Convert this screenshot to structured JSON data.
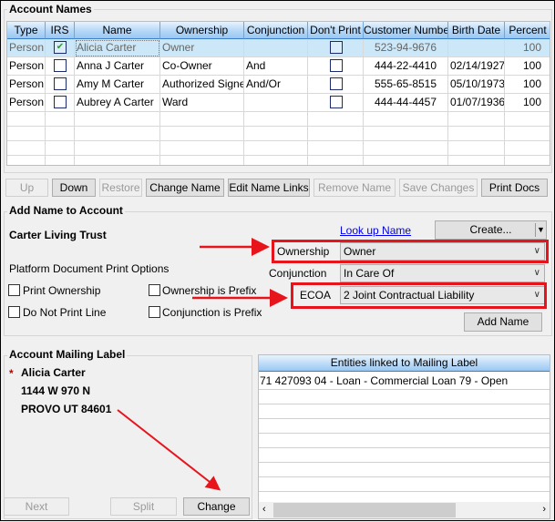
{
  "account_names": {
    "title": "Account Names",
    "columns": [
      "Type",
      "IRS",
      "Name",
      "Ownership",
      "Conjunction",
      "Don't Print",
      "Customer Number",
      "Birth Date",
      "Percent"
    ],
    "rows": [
      {
        "type": "Person",
        "irs": true,
        "name": "Alicia Carter",
        "ownership": "Owner",
        "conjunction": "",
        "dont_print": false,
        "customer_number": "523-94-9676",
        "birth_date": "",
        "percent": "100",
        "selected": true
      },
      {
        "type": "Person",
        "irs": false,
        "name": "Anna J Carter",
        "ownership": "Co-Owner",
        "conjunction": "And",
        "dont_print": false,
        "customer_number": "444-22-4410",
        "birth_date": "02/14/1927",
        "percent": "100"
      },
      {
        "type": "Person",
        "irs": false,
        "name": "Amy M Carter",
        "ownership": "Authorized Signer",
        "conjunction": "And/Or",
        "dont_print": false,
        "customer_number": "555-65-8515",
        "birth_date": "05/10/1973",
        "percent": "100"
      },
      {
        "type": "Person",
        "irs": false,
        "name": "Aubrey A Carter",
        "ownership": "Ward",
        "conjunction": "",
        "dont_print": false,
        "customer_number": "444-44-4457",
        "birth_date": "01/07/1936",
        "percent": "100"
      }
    ]
  },
  "toolbar": {
    "up": "Up",
    "down": "Down",
    "restore": "Restore",
    "change_name": "Change Name",
    "edit_name_links": "Edit Name Links",
    "remove_name": "Remove Name",
    "save_changes": "Save Changes",
    "print_docs": "Print Docs"
  },
  "add_name": {
    "title": "Add Name to Account",
    "account_title": "Carter  Living Trust",
    "lookup_link": "Look up Name",
    "create_button": "Create...",
    "ownership_label": "Ownership",
    "ownership_value": "Owner",
    "conjunction_label": "Conjunction",
    "conjunction_value": "In Care Of",
    "ecoa_label": "ECOA",
    "ecoa_value": "2 Joint Contractual Liability",
    "print_options_label": "Platform Document Print Options",
    "print_ownership": "Print Ownership",
    "ownership_is_prefix": "Ownership is Prefix",
    "do_not_print_line": "Do Not Print Line",
    "conjunction_is_prefix": "Conjunction is Prefix",
    "add_name_button": "Add Name"
  },
  "mailing_label": {
    "title": "Account Mailing Label",
    "required_marker": "*",
    "lines": [
      "Alicia Carter",
      "1144 W 970 N",
      "PROVO UT 84601"
    ],
    "next": "Next",
    "split": "Split",
    "change": "Change"
  },
  "entities": {
    "header": "Entities linked to Mailing Label",
    "rows": [
      "71 427093 04 - Loan - Commercial  Loan 79 - Open"
    ]
  },
  "colors": {
    "annotation": "#e8141c",
    "header_blue": "#99c7f3",
    "link": "#0000ee"
  }
}
